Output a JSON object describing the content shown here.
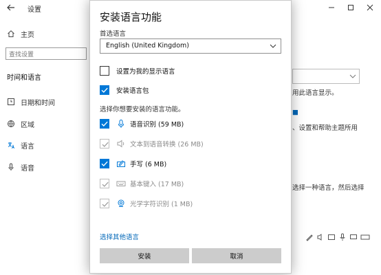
{
  "window": {
    "title": "设置",
    "accent": "#0078d7"
  },
  "sidebar": {
    "home": "主页",
    "search_placeholder": "查找设置",
    "heading": "时间和语言",
    "items": [
      {
        "label": "日期和时间",
        "icon": "clock-icon"
      },
      {
        "label": "区域",
        "icon": "globe-icon"
      },
      {
        "label": "语言",
        "icon": "language-icon"
      },
      {
        "label": "语音",
        "icon": "microphone-icon"
      }
    ]
  },
  "background": {
    "line1": "用此语言显示。",
    "line2": "、设置和帮助主题所用",
    "line3": "选择一种语言，然后选择"
  },
  "dialog": {
    "title": "安装语言功能",
    "preferred_label": "首选语言",
    "preferred_value": "English (United Kingdom)",
    "section_label": "选择你想要安装的语言功能。",
    "options": [
      {
        "label": "设置为我的显示语言",
        "state": "unchecked"
      },
      {
        "label": "安装语言包",
        "state": "checked"
      }
    ],
    "features": [
      {
        "label": "语音识别 (59 MB)",
        "state": "checked",
        "icon": "microphone-icon"
      },
      {
        "label": "文本到语音转换 (26 MB)",
        "state": "disabled",
        "icon": "speaker-icon"
      },
      {
        "label": "手写 (6 MB)",
        "state": "checked",
        "icon": "handwriting-icon"
      },
      {
        "label": "基本键入 (17 MB)",
        "state": "disabled",
        "icon": "keyboard-icon"
      },
      {
        "label": "光学字符识别 (1 MB)",
        "state": "disabled",
        "icon": "ocr-icon"
      }
    ],
    "other_link": "选择其他语言",
    "install_button": "安装",
    "cancel_button": "取消"
  }
}
